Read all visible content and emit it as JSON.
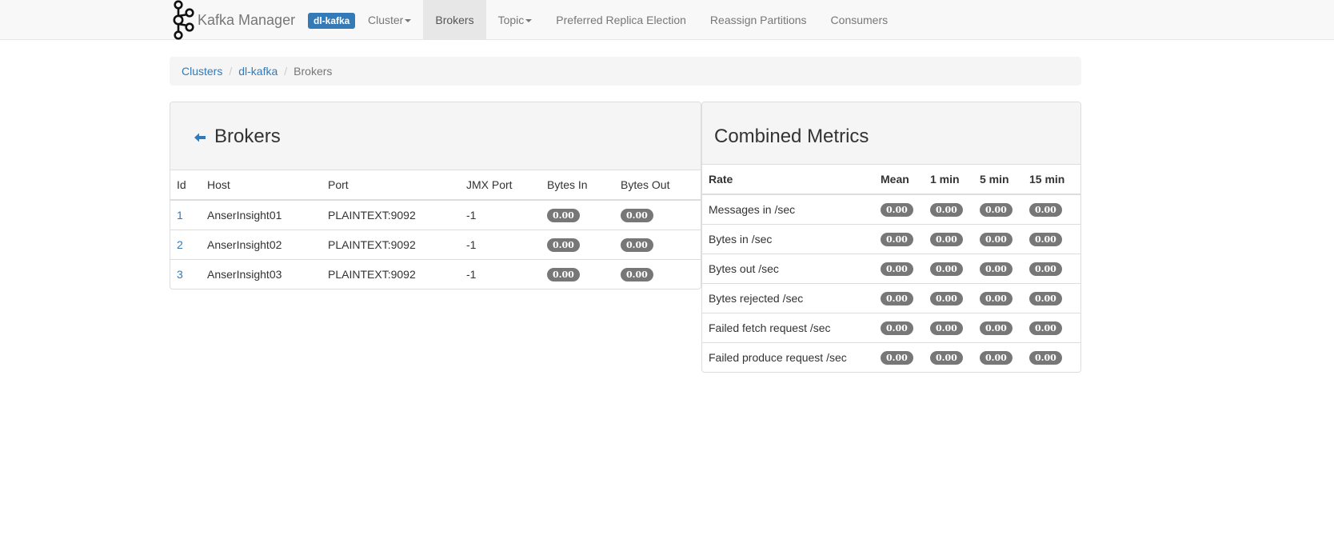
{
  "navbar": {
    "brand": "Kafka Manager",
    "cluster_badge": "dl-kafka",
    "items": [
      {
        "label": "Cluster",
        "dropdown": true,
        "active": false
      },
      {
        "label": "Brokers",
        "dropdown": false,
        "active": true
      },
      {
        "label": "Topic",
        "dropdown": true,
        "active": false
      },
      {
        "label": "Preferred Replica Election",
        "dropdown": false,
        "active": false
      },
      {
        "label": "Reassign Partitions",
        "dropdown": false,
        "active": false
      },
      {
        "label": "Consumers",
        "dropdown": false,
        "active": false
      }
    ]
  },
  "breadcrumb": {
    "items": [
      "Clusters",
      "dl-kafka",
      "Brokers"
    ]
  },
  "brokers_panel": {
    "title": "Brokers",
    "icon": "arrow-left-icon",
    "columns": [
      "Id",
      "Host",
      "Port",
      "JMX Port",
      "Bytes In",
      "Bytes Out"
    ],
    "rows": [
      {
        "id": "1",
        "host": "AnserInsight01",
        "port": "PLAINTEXT:9092",
        "jmx_port": "-1",
        "bytes_in": "0.00",
        "bytes_out": "0.00"
      },
      {
        "id": "2",
        "host": "AnserInsight02",
        "port": "PLAINTEXT:9092",
        "jmx_port": "-1",
        "bytes_in": "0.00",
        "bytes_out": "0.00"
      },
      {
        "id": "3",
        "host": "AnserInsight03",
        "port": "PLAINTEXT:9092",
        "jmx_port": "-1",
        "bytes_in": "0.00",
        "bytes_out": "0.00"
      }
    ]
  },
  "metrics_panel": {
    "title": "Combined Metrics",
    "columns": [
      "Rate",
      "Mean",
      "1 min",
      "5 min",
      "15 min"
    ],
    "rows": [
      {
        "rate": "Messages in /sec",
        "mean": "0.00",
        "min1": "0.00",
        "min5": "0.00",
        "min15": "0.00"
      },
      {
        "rate": "Bytes in /sec",
        "mean": "0.00",
        "min1": "0.00",
        "min5": "0.00",
        "min15": "0.00"
      },
      {
        "rate": "Bytes out /sec",
        "mean": "0.00",
        "min1": "0.00",
        "min5": "0.00",
        "min15": "0.00"
      },
      {
        "rate": "Bytes rejected /sec",
        "mean": "0.00",
        "min1": "0.00",
        "min5": "0.00",
        "min15": "0.00"
      },
      {
        "rate": "Failed fetch request /sec",
        "mean": "0.00",
        "min1": "0.00",
        "min5": "0.00",
        "min15": "0.00"
      },
      {
        "rate": "Failed produce request /sec",
        "mean": "0.00",
        "min1": "0.00",
        "min5": "0.00",
        "min15": "0.00"
      }
    ]
  },
  "colors": {
    "link": "#337ab7",
    "badge": "#777777",
    "navbar_bg": "#f8f8f8",
    "active_nav_bg": "#e7e7e7",
    "panel_heading_bg": "#f5f5f5"
  }
}
